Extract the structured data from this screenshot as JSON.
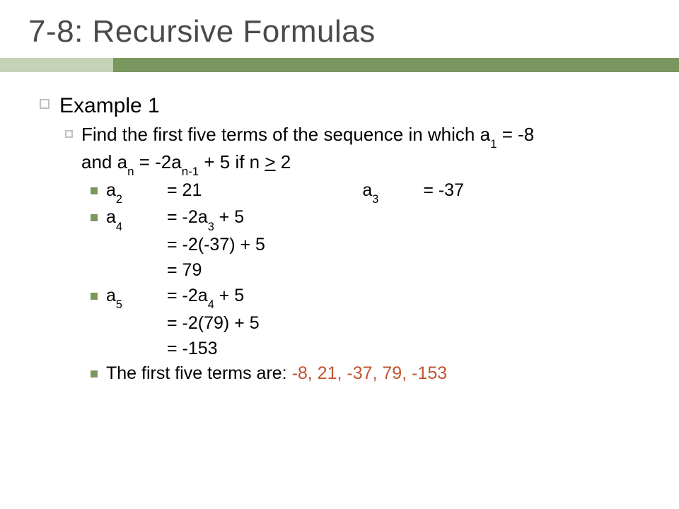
{
  "title": "7-8: Recursive Formulas",
  "example_label": "Example 1",
  "problem_line1_a": "Find the first five terms of the sequence in which a",
  "problem_line1_sub1": "1",
  "problem_line1_b": " = -8",
  "problem_line2_a": "and a",
  "problem_line2_sub1": "n",
  "problem_line2_b": " = -2a",
  "problem_line2_sub2": "n-1",
  "problem_line2_c": " + 5 if n ",
  "problem_line2_ge": ">",
  "problem_line2_d": " 2",
  "a2_label_a": "a",
  "a2_label_sub": "2",
  "a2_val": "= 21",
  "a3_label_a": "a",
  "a3_label_sub": "3",
  "a3_val": "= -37",
  "a4_label_a": "a",
  "a4_label_sub": "4",
  "a4_line1_a": "= -2a",
  "a4_line1_sub": "3",
  "a4_line1_b": " + 5",
  "a4_line2": "= -2(-37) + 5",
  "a4_line3": "= 79",
  "a5_label_a": "a",
  "a5_label_sub": "5",
  "a5_line1_a": "= -2a",
  "a5_line1_sub": "4",
  "a5_line1_b": " + 5",
  "a5_line2": "= -2(79) + 5",
  "a5_line3": "= -153",
  "summary_prefix": "The first five terms are: ",
  "summary_answer": "-8, 21, -37, 79, -153"
}
